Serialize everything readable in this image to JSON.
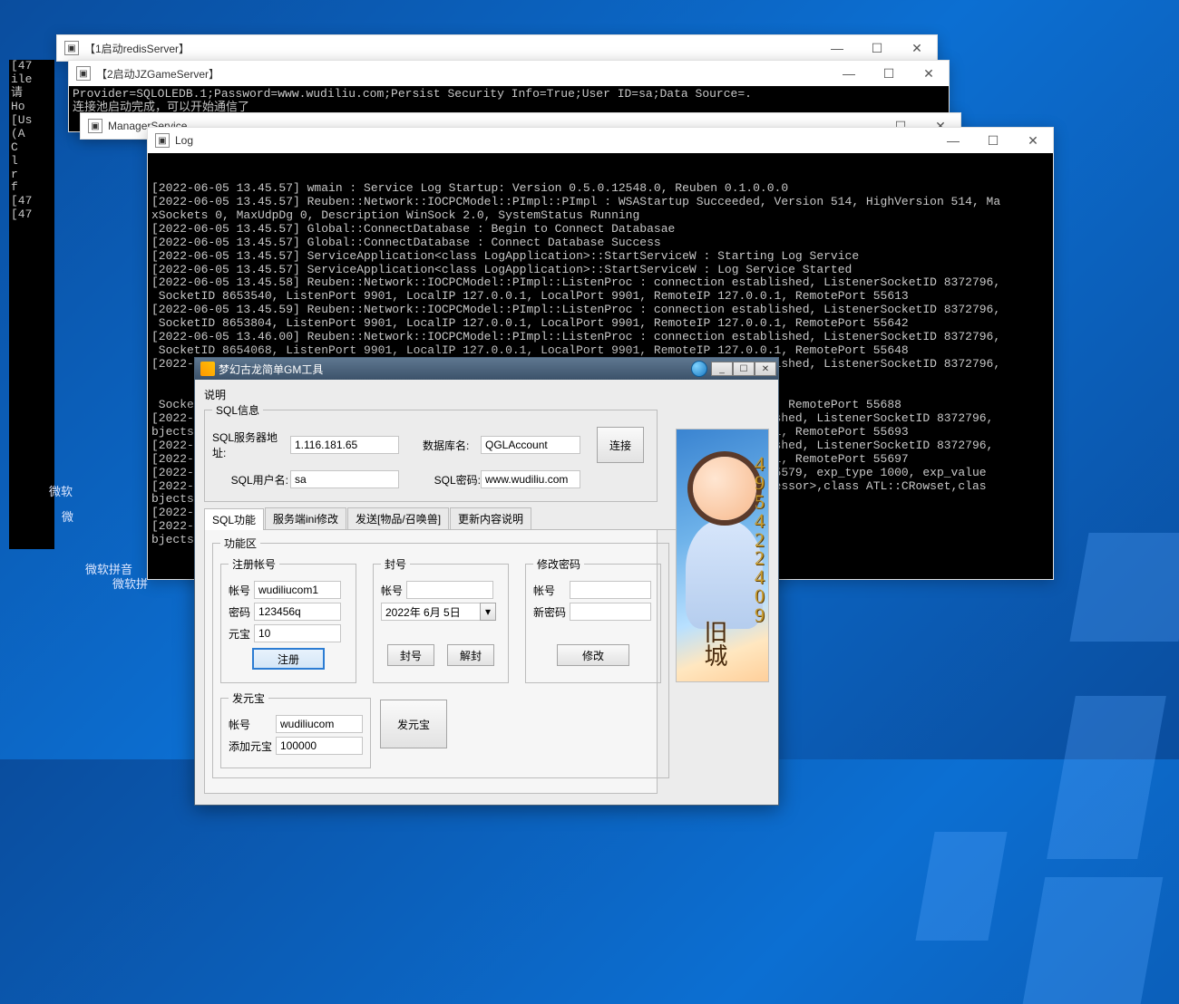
{
  "windows": {
    "redis": {
      "title": "【1启动redisServer】"
    },
    "game": {
      "title": "【2启动JZGameServer】",
      "lines": "Provider=SQLOLEDB.1;Password=www.wudiliu.com;Persist Security Info=True;User ID=sa;Data Source=.\n连接池启动完成，可以开始通信了"
    },
    "mgr": {
      "title": "ManagerService"
    },
    "log": {
      "title": "Log",
      "lines": "[2022-06-05 13.45.57] wmain : Service Log Startup: Version 0.5.0.12548.0, Reuben 0.1.0.0.0\n[2022-06-05 13.45.57] Reuben::Network::IOCPCModel::PImpl::PImpl : WSAStartup Succeeded, Version 514, HighVersion 514, Ma\nxSockets 0, MaxUdpDg 0, Description WinSock 2.0, SystemStatus Running\n[2022-06-05 13.45.57] Global::ConnectDatabase : Begin to Connect Databasae\n[2022-06-05 13.45.57] Global::ConnectDatabase : Connect Database Success\n[2022-06-05 13.45.57] ServiceApplication<class LogApplication>::StartServiceW : Starting Log Service\n[2022-06-05 13.45.57] ServiceApplication<class LogApplication>::StartServiceW : Log Service Started\n[2022-06-05 13.45.58] Reuben::Network::IOCPCModel::PImpl::ListenProc : connection established, ListenerSocketID 8372796,\n SocketID 8653540, ListenPort 9901, LocalIP 127.0.0.1, LocalPort 9901, RemoteIP 127.0.0.1, RemotePort 55613\n[2022-06-05 13.45.59] Reuben::Network::IOCPCModel::PImpl::ListenProc : connection established, ListenerSocketID 8372796,\n SocketID 8653804, ListenPort 9901, LocalIP 127.0.0.1, LocalPort 9901, RemoteIP 127.0.0.1, RemotePort 55642\n[2022-06-05 13.46.00] Reuben::Network::IOCPCModel::PImpl::ListenProc : connection established, ListenerSocketID 8372796,\n SocketID 8654068, ListenPort 9901, LocalIP 127.0.0.1, LocalPort 9901, RemoteIP 127.0.0.1, RemotePort 55648\n[2022-06-05 13.46.29] Reuben::Network::IOCPCModel::PImpl::ListenProc : connection established, ListenerSocketID 8372796,",
      "tail": " Socket                                                                                1, RemotePort 55688\n[2022-06                                                                               ished, ListenerSocketID 8372796,\nbjects 2  Sock                                                                          1, RemotePort 55693\n[2022-06                                                                               ished, ListenerSocketID 8372796,\n[2022-06  Sock                                                                          1, RemotePort 55697\n[2022-06-164, a                                                                        -5579, exp_type 1000, exp_value\n[2022-06s ATL:                                                                         cessor>,class ATL::CRowset,clas\nbjects 2 Micros\n[2022-06 Micros\n[2022-06\nbjects 2"
    },
    "behind_left": "[47\nile\n请\nHo\n[Us\n(A\nC\nl\nr\nf\n[47\n[47"
  },
  "ime_labels": {
    "l1": "微软",
    "l2": "微",
    "l3": "微软拼音",
    "l4": "微软拼"
  },
  "gm": {
    "title": "梦幻古龙简单GM工具",
    "desc": "说明",
    "sql_group": "SQL信息",
    "server_addr_label": "SQL服务器地址:",
    "server_addr": "1.116.181.65",
    "db_label": "数据库名:",
    "db_name": "QGLAccount",
    "user_label": "SQL用户名:",
    "user": "sa",
    "pwd_label": "SQL密码:",
    "pwd": "www.wudiliu.com",
    "connect": "连接",
    "tabs": [
      "SQL功能",
      "服务端ini修改",
      "发送[物品/召唤兽]",
      "更新内容说明"
    ],
    "func_group": "功能区",
    "register": {
      "legend": "注册帐号",
      "acc_label": "帐号",
      "acc": "wudiliucom1",
      "pwd_label": "密码",
      "pwd": "123456q",
      "gold_label": "元宝",
      "gold": "10",
      "btn": "注册"
    },
    "ban": {
      "legend": "封号",
      "acc_label": "帐号",
      "date": "2022年 6月 5日",
      "ban_btn": "封号",
      "unban_btn": "解封"
    },
    "chpwd": {
      "legend": "修改密码",
      "acc_label": "帐号",
      "new_label": "新密码",
      "btn": "修改"
    },
    "sendgold": {
      "legend": "发元宝",
      "acc_label": "帐号",
      "acc": "wudiliucom",
      "add_label": "添加元宝",
      "amount": "100000",
      "btn": "发元宝"
    },
    "side_digits": "4\n9\n5\n4\n2\n2\n4\n0\n9",
    "side_mark": "旧城"
  }
}
